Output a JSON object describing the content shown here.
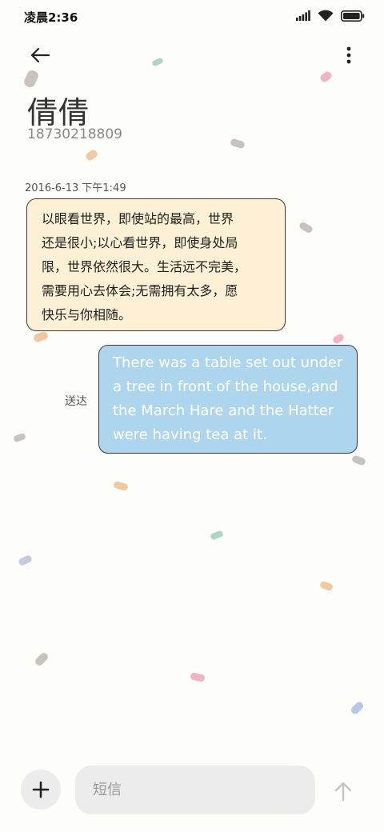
{
  "status_bar": {
    "time": "凌晨2:36"
  },
  "header": {
    "back_icon": "arrow-left-icon",
    "more_icon": "more-vertical-icon"
  },
  "contact": {
    "name": "倩倩",
    "number": "18730218809"
  },
  "conversation": {
    "timestamp": "2016-6-13 下午1:49",
    "received_lines": [
      "以眼看世界，即使站的最高，世界",
      "还是很小;以心看世界，即使身处局",
      "限，世界依然很大。生活远不完美，",
      "需要用心去体会;无需拥有太多，愿",
      "快乐与你相随。"
    ],
    "sent_lines": [
      "There was a table set out under",
      "a tree in front of the house,and",
      "the March Hare and the Hatter",
      "were having tea at it."
    ],
    "delivery_status": "送达"
  },
  "composer": {
    "add_icon": "plus-icon",
    "input_placeholder": "短信",
    "input_value": "",
    "send_icon": "arrow-up-icon"
  },
  "colors": {
    "background": "#fdfdf9",
    "received_bubble": "#fdf0d5",
    "sent_bubble": "#aed5ee",
    "bubble_border": "#3a3a3a",
    "confetti": [
      "#c9c2bf",
      "#a8d8c3",
      "#f2b4c4",
      "#f3c89e",
      "#c4ccdc",
      "#b8c8e8"
    ]
  }
}
